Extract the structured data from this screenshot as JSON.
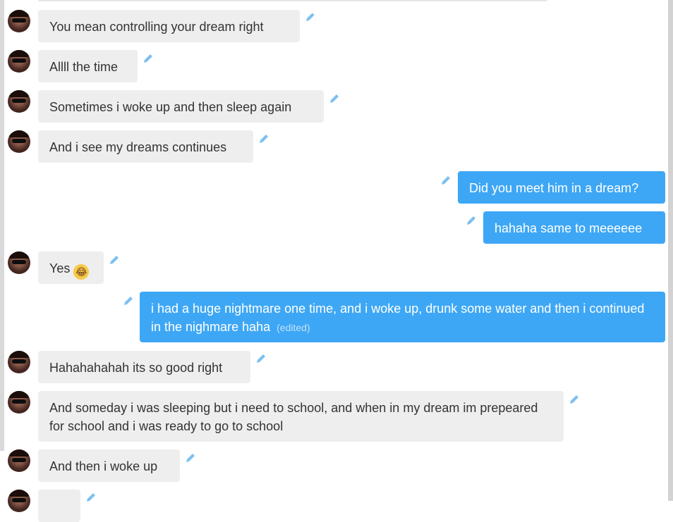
{
  "chat": {
    "messages": [
      {
        "id": "m1",
        "direction": "in",
        "text": "You mean controlling your dream right"
      },
      {
        "id": "m2",
        "direction": "in",
        "text": "Allll the time"
      },
      {
        "id": "m3",
        "direction": "in",
        "text": "Sometimes i woke up and then sleep again"
      },
      {
        "id": "m4",
        "direction": "in",
        "text": "And i see my dreams continues"
      },
      {
        "id": "m5",
        "direction": "out",
        "text": "Did you meet him in a dream?"
      },
      {
        "id": "m6",
        "direction": "out",
        "text": "hahaha same to meeeeee"
      },
      {
        "id": "m7",
        "direction": "in",
        "text": "Yes",
        "emoji": "😂"
      },
      {
        "id": "m8",
        "direction": "out",
        "text": "i had a huge nightmare one time, and i woke up, drunk some water and then i continued in the nighmare haha",
        "edited_label": "(edited)"
      },
      {
        "id": "m9",
        "direction": "in",
        "text": "Hahahahahah its so good right"
      },
      {
        "id": "m10",
        "direction": "in",
        "text": "And someday i was sleeping but i need to school, and when in my dream im prepeared for school and i was ready to go to school"
      },
      {
        "id": "m11",
        "direction": "in",
        "text": "And then i woke up"
      }
    ]
  },
  "colors": {
    "incoming_bubble": "#eeeeee",
    "outgoing_bubble": "#3ea7f5",
    "pencil": "#7ec0f0"
  },
  "icons": {
    "edit": "pencil-icon",
    "avatar": "user-avatar"
  }
}
